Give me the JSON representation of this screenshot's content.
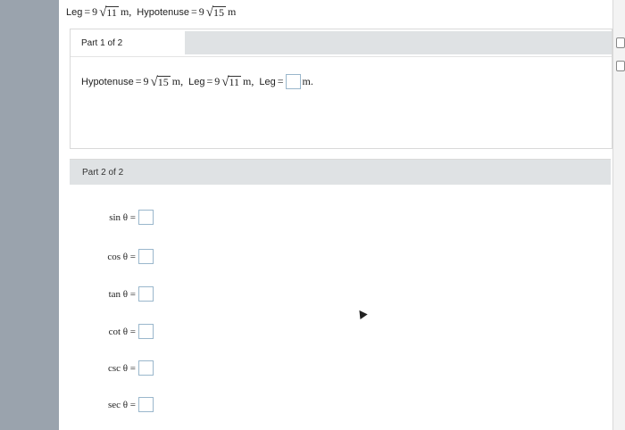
{
  "given": {
    "leg_label": "Leg",
    "eq": "=",
    "leg_coef": "9",
    "leg_radicand": "11",
    "leg_unit": "m,",
    "hyp_label": "Hypotenuse",
    "hyp_coef": "9",
    "hyp_radicand": "15",
    "hyp_unit": "m"
  },
  "part1": {
    "title": "Part 1 of 2",
    "hyp_label": "Hypotenuse",
    "hyp_coef": "9",
    "hyp_radicand": "15",
    "hyp_unit": "m,",
    "leg_label": "Leg",
    "leg_coef": "9",
    "leg_radicand": "11",
    "leg_unit": "m,",
    "leg2_label": "Leg",
    "answer_unit": "m."
  },
  "part2": {
    "title": "Part 2 of 2",
    "rows": [
      {
        "label": "sin θ ="
      },
      {
        "label": "cos θ ="
      },
      {
        "label": "tan θ ="
      },
      {
        "label": "cot θ ="
      },
      {
        "label": "csc θ ="
      },
      {
        "label": "sec θ ="
      }
    ]
  }
}
